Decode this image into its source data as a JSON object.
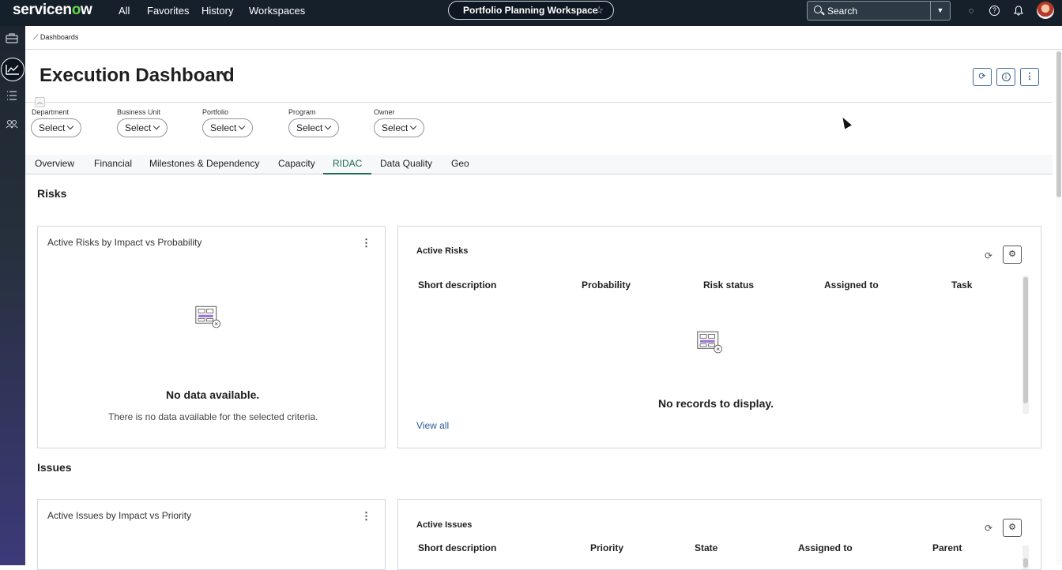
{
  "topbar": {
    "logo_text": "servicenow",
    "nav": [
      "All",
      "Favorites",
      "History",
      "Workspaces"
    ],
    "workspace_label": "Portfolio Planning Workspace",
    "search_placeholder": "Search"
  },
  "breadcrumb": "Dashboards",
  "header": {
    "title": "Execution Dashboard"
  },
  "filters": [
    {
      "label": "Department",
      "value": "Select"
    },
    {
      "label": "Business Unit",
      "value": "Select"
    },
    {
      "label": "Portfolio",
      "value": "Select"
    },
    {
      "label": "Program",
      "value": "Select"
    },
    {
      "label": "Owner",
      "value": "Select"
    }
  ],
  "tabs": [
    "Overview",
    "Financial",
    "Milestones & Dependency",
    "Capacity",
    "RIDAC",
    "Data Quality",
    "Geo"
  ],
  "active_tab": "RIDAC",
  "risks": {
    "section_title": "Risks",
    "chart_card": {
      "title": "Active Risks by Impact vs Probability",
      "empty_title": "No data available.",
      "empty_sub": "There is no data available for the selected criteria."
    },
    "list_card": {
      "title": "Active Risks",
      "columns": [
        "Short description",
        "Probability",
        "Risk status",
        "Assigned to",
        "Task"
      ],
      "empty_text": "No records to display.",
      "link": "View all"
    }
  },
  "issues": {
    "section_title": "Issues",
    "chart_card": {
      "title": "Active Issues by Impact vs Priority"
    },
    "list_card": {
      "title": "Active Issues",
      "columns": [
        "Short description",
        "Priority",
        "State",
        "Assigned to",
        "Parent"
      ]
    }
  },
  "colors": {
    "topbar": "#16202b",
    "accent_tab": "#1d6b54",
    "link": "#2b5b9e",
    "empty_icon_accent": "#9b74d6"
  }
}
